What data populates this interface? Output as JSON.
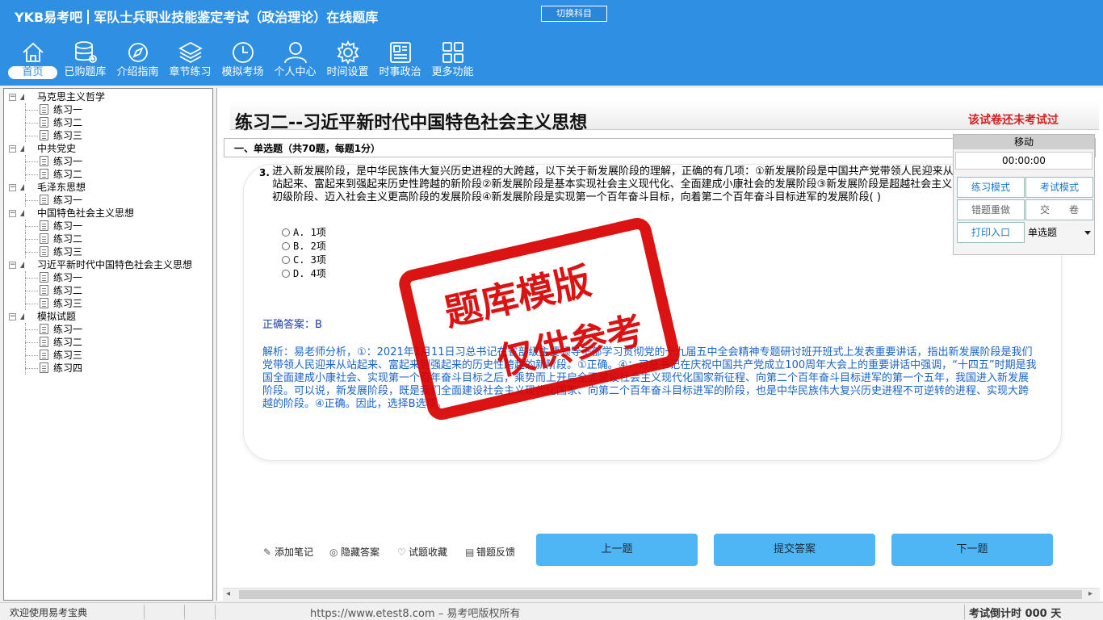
{
  "header": {
    "logo": "YKB易考吧",
    "title": "军队士兵职业技能鉴定考试（政治理论）在线题库",
    "switch_label": "切换科目",
    "nav": [
      {
        "label": "首页",
        "icon": "home-icon"
      },
      {
        "label": "已购题库",
        "icon": "database-icon"
      },
      {
        "label": "介绍指南",
        "icon": "compass-icon"
      },
      {
        "label": "章节练习",
        "icon": "layers-icon"
      },
      {
        "label": "模拟考场",
        "icon": "clock-icon"
      },
      {
        "label": "个人中心",
        "icon": "user-icon"
      },
      {
        "label": "时间设置",
        "icon": "gear-icon"
      },
      {
        "label": "时事政治",
        "icon": "news-icon"
      },
      {
        "label": "更多功能",
        "icon": "grid-icon"
      }
    ]
  },
  "tree": [
    {
      "label": "马克思主义哲学",
      "children": [
        "练习一",
        "练习二",
        "练习三"
      ]
    },
    {
      "label": "中共党史",
      "children": [
        "练习一",
        "练习二"
      ]
    },
    {
      "label": "毛泽东思想",
      "children": [
        "练习一"
      ]
    },
    {
      "label": "中国特色社会主义思想",
      "children": [
        "练习一",
        "练习二",
        "练习三"
      ]
    },
    {
      "label": "习近平新时代中国特色社会主义思想",
      "children": [
        "练习一",
        "练习二",
        "练习三"
      ]
    },
    {
      "label": "模拟试题",
      "children": [
        "练习一",
        "练习二",
        "练习三",
        "练习四"
      ]
    }
  ],
  "main": {
    "title": "练习二--习近平新时代中国特色社会主义思想",
    "not_taken": "该试卷还未考试过",
    "section": "一、单选题（共70题，每题1分）",
    "question_number": "3.",
    "question_text": "进入新发展阶段，是中华民族伟大复兴历史进程的大跨越，以下关于新发展阶段的理解，正确的有几项：①新发展阶段是中国共产党带领人民迎来从站起来、富起来到强起来历史性跨越的新阶段②新发展阶段是基本实现社会主义现代化、全面建成小康社会的发展阶段③新发展阶段是超越社会主义初级阶段、迈入社会主义更高阶段的发展阶段④新发展阶段是实现第一个百年奋斗目标，向着第二个百年奋斗目标进军的发展阶段( )",
    "options": [
      "A. 1项",
      "B. 2项",
      "C. 3项",
      "D. 4项"
    ],
    "answer": "正确答案：B",
    "analysis": "解析：易老师分析，①：2021年1月11日习总书记在省部级主要领导干部学习贯彻党的十九届五中全会精神专题研讨班开班式上发表重要讲话，指出新发展阶段是我们党带领人民迎来从站起来、富起来到强起来的历史性跨越的新阶段。①正确。④：习总书记在庆祝中国共产党成立100周年大会上的重要讲话中强调，“十四五”时期是我国全面建成小康社会、实现第一个百年奋斗目标之后，乘势而上开启全面建设社会主义现代化国家新征程、向第二个百年奋斗目标进军的第一个五年，我国进入新发展阶段。可以说，新发展阶段，既是我们全面建设社会主义现代化国家、向第二个百年奋斗目标进军的阶段，也是中华民族伟大复兴历史进程不可逆转的进程、实现大跨越的阶段。④正确。因此，选择B选项。",
    "stamp_line1": "题库模版",
    "stamp_line2": "仅供参考",
    "tools": [
      "添加笔记",
      "隐藏答案",
      "试题收藏",
      "错题反馈"
    ],
    "prev": "上一题",
    "submit": "提交答案",
    "next": "下一题"
  },
  "float_panel": {
    "move": "移动",
    "timer": "00:00:00",
    "practice_mode": "练习模式",
    "exam_mode": "考试模式",
    "redo_wrong": "错题重做",
    "hand_in": "交　　卷",
    "print": "打印入口",
    "question_type": "单选题"
  },
  "status": {
    "welcome": "欢迎使用易考宝典",
    "url": "https://www.etest8.com – 易考吧版权所有",
    "countdown": "考试倒计时 000 天"
  }
}
